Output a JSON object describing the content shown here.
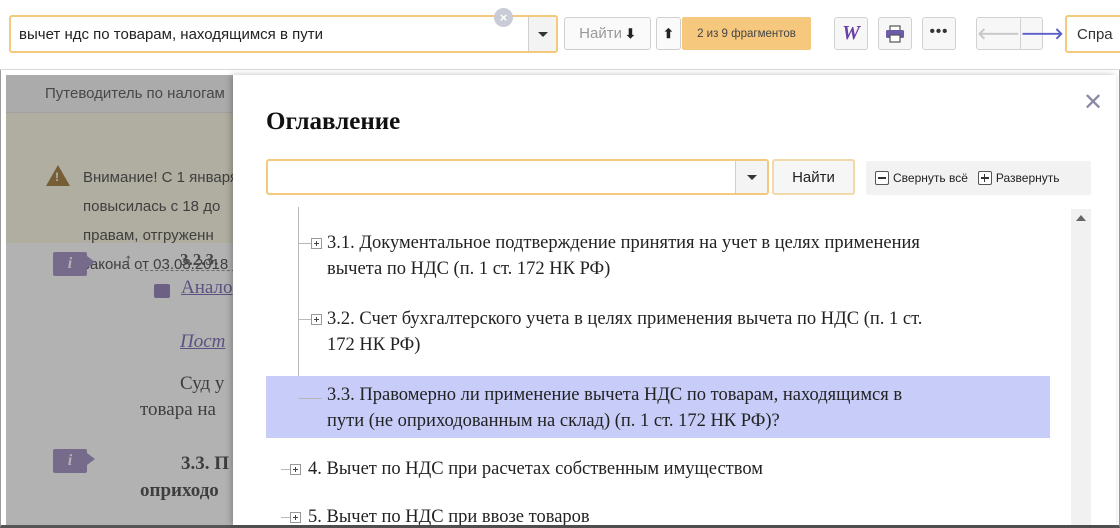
{
  "toolbar": {
    "search_value": "вычет ндс по товарам, находящимся в пути",
    "find_label": "Найти",
    "match_count": "2 из 9 фрагментов",
    "help_placeholder": "Спра"
  },
  "document": {
    "breadcrumb": "Путеводитель по налогам",
    "warning_lines": [
      "Внимание! С 1 января",
      "повысилась с 18 до",
      "правам, отгруженн",
      "закона от 03.08.2018"
    ],
    "section_ref": "3.2.3.",
    "analog_link": "Анало",
    "post_link": "Пост",
    "para_line1": "Суд у",
    "para_line2": "товара на",
    "section_heading": "3.3.  П",
    "section_heading2": "оприходо"
  },
  "toc_modal": {
    "title": "Оглавление",
    "search_value": "",
    "find_label": "Найти",
    "collapse_all": "Свернуть всё",
    "expand_all": "Развернуть",
    "items": [
      {
        "line1": "3.1. Документальное подтверждение принятия на учет в целях применения",
        "line2": "вычета по НДС (п. 1 ст. 172 НК РФ)"
      },
      {
        "line1": "3.2. Счет бухгалтерского учета в целях применения вычета по НДС (п. 1 ст.",
        "line2": "172 НК РФ)"
      },
      {
        "line1": "3.3. Правомерно ли применение вычета НДС по товарам, находящимся в",
        "line2": "пути (не оприходованным на склад) (п. 1 ст. 172 НК РФ)?"
      },
      {
        "line1": "4. Вычет по НДС при расчетах собственным имуществом"
      },
      {
        "line1": "5. Вычет по НДС при ввозе товаров"
      }
    ]
  },
  "colors": {
    "accent_orange": "#f2c97d",
    "selection": "#c7cdf8",
    "link_purple": "#5a45a0"
  }
}
